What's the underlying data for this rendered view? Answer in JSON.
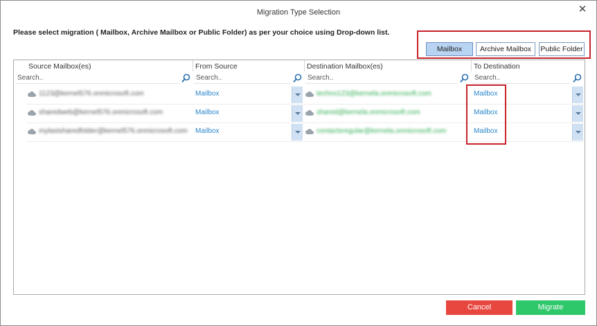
{
  "window": {
    "title": "Migration Type Selection"
  },
  "instruction": "Please select migration ( Mailbox, Archive Mailbox or Public Folder) as per your choice using Drop-down list.",
  "migration_types": {
    "options": [
      {
        "label": "Mailbox",
        "selected": true
      },
      {
        "label": "Archive Mailbox",
        "selected": false
      },
      {
        "label": "Public Folder",
        "selected": false
      }
    ]
  },
  "columns": {
    "source": "Source Mailbox(es)",
    "from_source": "From Source",
    "destination": "Destination Mailbox(es)",
    "to_destination": "To Destination"
  },
  "search": {
    "placeholder": "Search.."
  },
  "rows": [
    {
      "source": "1123@kernel576.onmicrosoft.com",
      "from": "Mailbox",
      "destination": "techno123@kernela.onmicrosoft.com",
      "to": "Mailbox"
    },
    {
      "source": "sharedweb@kernel576.onmicrosoft.com",
      "from": "Mailbox",
      "destination": "shared@kernela.onmicrosoft.com",
      "to": "Mailbox"
    },
    {
      "source": "mylastsharedfolder@kernel576.onmicrosoft.com",
      "from": "Mailbox",
      "destination": "contactsregular@kernela.onmicrosoft.com",
      "to": "Mailbox"
    }
  ],
  "buttons": {
    "cancel": "Cancel",
    "migrate": "Migrate"
  },
  "colors": {
    "accent": "#2a86cc",
    "cancel": "#e8473f",
    "migrate": "#2ec76a",
    "highlight": "#c8202a"
  }
}
